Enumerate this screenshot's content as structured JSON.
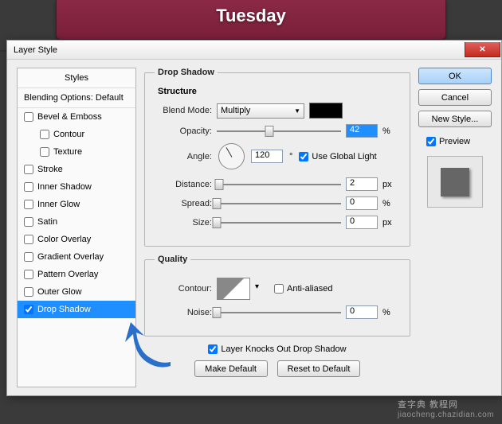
{
  "banner": {
    "title": "Tuesday"
  },
  "dialog": {
    "title": "Layer Style",
    "styles_header": "Styles",
    "blending_label": "Blending Options: Default",
    "items": {
      "bevel": "Bevel & Emboss",
      "contour_sub": "Contour",
      "texture_sub": "Texture",
      "stroke": "Stroke",
      "inner_shadow": "Inner Shadow",
      "inner_glow": "Inner Glow",
      "satin": "Satin",
      "color_overlay": "Color Overlay",
      "gradient_overlay": "Gradient Overlay",
      "pattern_overlay": "Pattern Overlay",
      "outer_glow": "Outer Glow",
      "drop_shadow": "Drop Shadow"
    }
  },
  "dropshadow": {
    "group_title": "Drop Shadow",
    "structure_label": "Structure",
    "blend_mode_label": "Blend Mode:",
    "blend_mode_value": "Multiply",
    "color": "#000000",
    "opacity_label": "Opacity:",
    "opacity_value": "42",
    "opacity_unit": "%",
    "angle_label": "Angle:",
    "angle_value": "120",
    "angle_unit": "°",
    "use_global": "Use Global Light",
    "distance_label": "Distance:",
    "distance_value": "2",
    "distance_unit": "px",
    "spread_label": "Spread:",
    "spread_value": "0",
    "spread_unit": "%",
    "size_label": "Size:",
    "size_value": "0",
    "size_unit": "px",
    "quality_label": "Quality",
    "contour_label": "Contour:",
    "anti_aliased": "Anti-aliased",
    "noise_label": "Noise:",
    "noise_value": "0",
    "noise_unit": "%",
    "knockout": "Layer Knocks Out Drop Shadow",
    "make_default": "Make Default",
    "reset_default": "Reset to Default"
  },
  "right": {
    "ok": "OK",
    "cancel": "Cancel",
    "new_style": "New Style...",
    "preview": "Preview"
  },
  "watermark": {
    "line1": "查字典 教程网",
    "line2": "jiaocheng.chazidian.com"
  }
}
